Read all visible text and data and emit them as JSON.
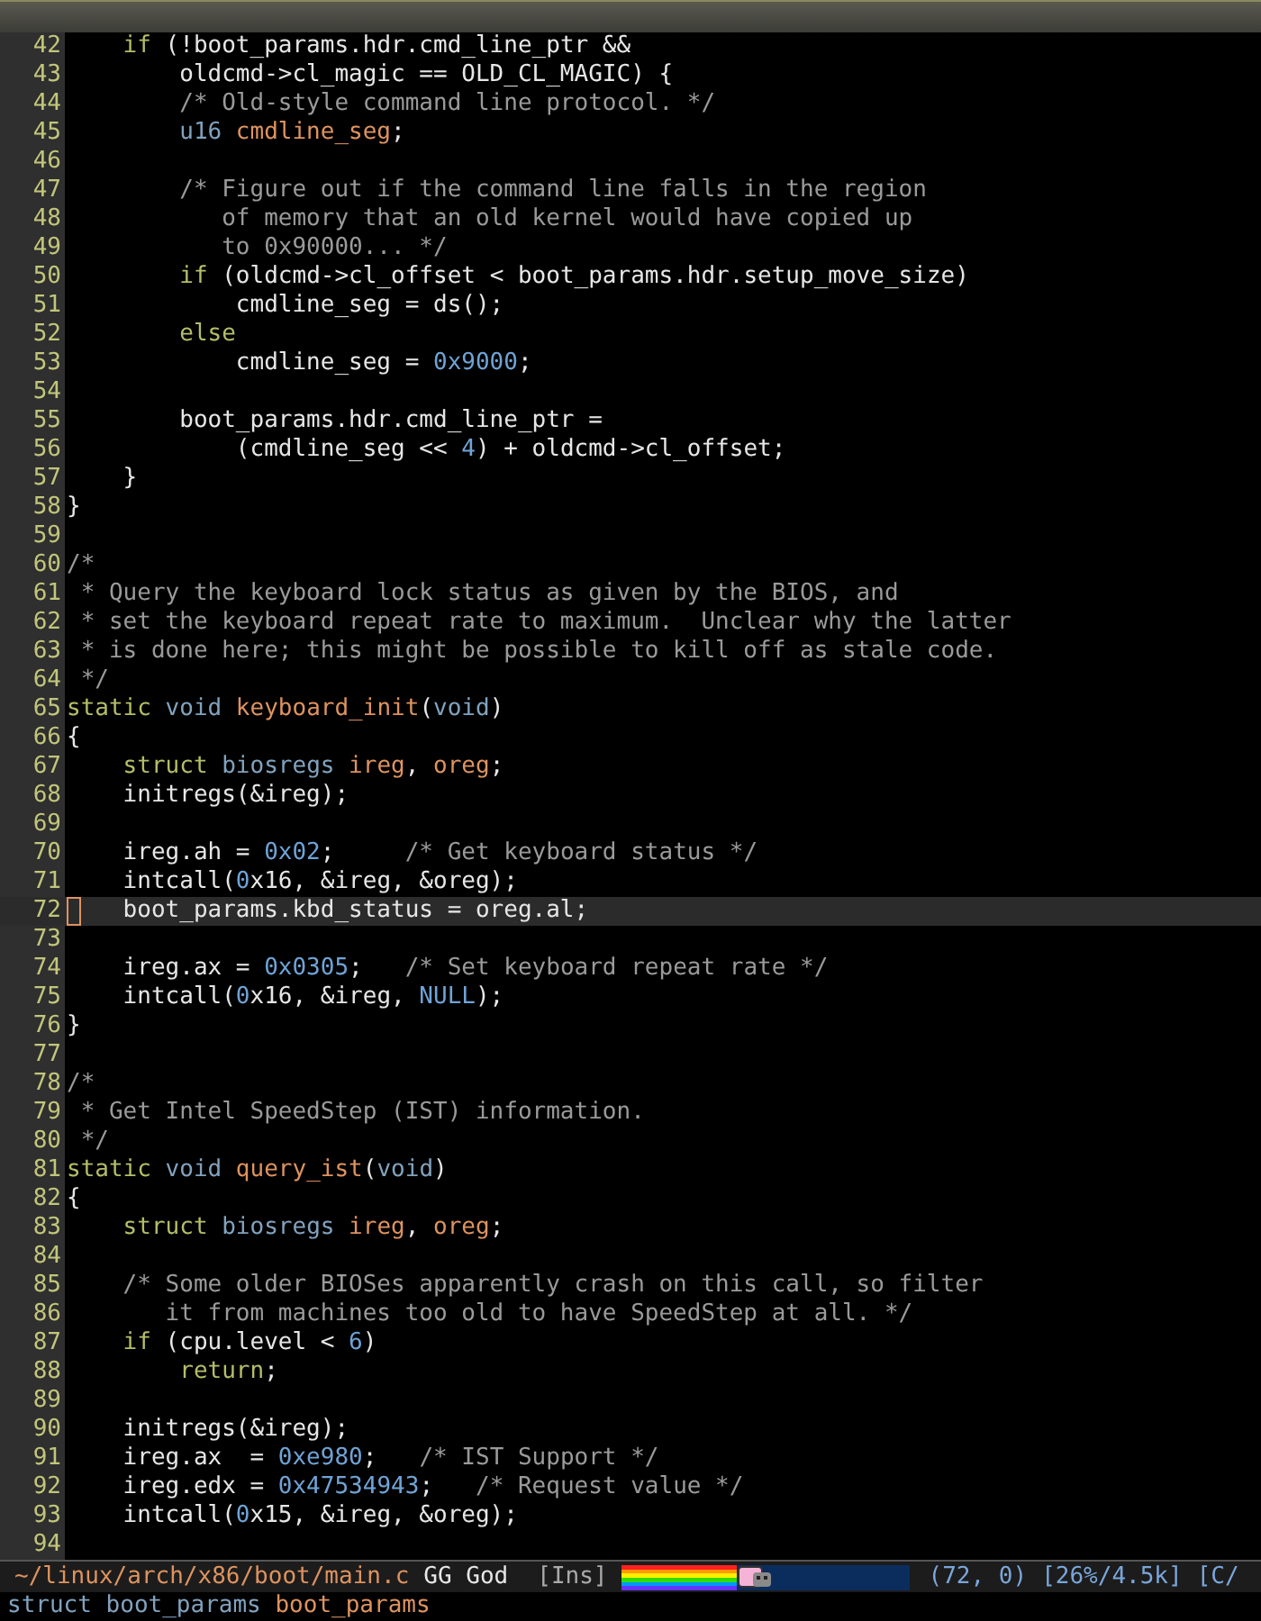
{
  "lines": [
    {
      "number": "42",
      "current": false,
      "segments": [
        {
          "kind": "keyword",
          "text": "    if"
        },
        {
          "kind": "plain",
          "text": " (!boot_params.hdr.cmd_line_ptr &&"
        }
      ]
    },
    {
      "number": "43",
      "current": false,
      "segments": [
        {
          "kind": "plain",
          "text": "        oldcmd->cl_magic == OLD_CL_MAGIC) {"
        }
      ]
    },
    {
      "number": "44",
      "current": false,
      "segments": [
        {
          "kind": "comment",
          "text": "        /* Old-style command line protocol. */"
        }
      ]
    },
    {
      "number": "45",
      "current": false,
      "segments": [
        {
          "kind": "type",
          "text": "        u16"
        },
        {
          "kind": "name",
          "text": " cmdline_seg"
        },
        {
          "kind": "plain",
          "text": ";"
        }
      ]
    },
    {
      "number": "46",
      "current": false
    },
    {
      "number": "47",
      "current": false,
      "segments": [
        {
          "kind": "comment",
          "text": "        /* Figure out if the command line falls in the region"
        }
      ]
    },
    {
      "number": "48",
      "current": false,
      "segments": [
        {
          "kind": "comment",
          "text": "           of memory that an old kernel would have copied up"
        }
      ]
    },
    {
      "number": "49",
      "current": false,
      "segments": [
        {
          "kind": "comment",
          "text": "           to 0x90000... */"
        }
      ]
    },
    {
      "number": "50",
      "current": false,
      "segments": [
        {
          "kind": "keyword",
          "text": "        if"
        },
        {
          "kind": "plain",
          "text": " (oldcmd->cl_offset < boot_params.hdr.setup_move_size)"
        }
      ]
    },
    {
      "number": "51",
      "current": false,
      "segments": [
        {
          "kind": "plain",
          "text": "            cmdline_seg = ds();"
        }
      ]
    },
    {
      "number": "52",
      "current": false,
      "segments": [
        {
          "kind": "keyword",
          "text": "        else"
        }
      ]
    },
    {
      "number": "53",
      "current": false,
      "segments": [
        {
          "kind": "plain",
          "text": "            cmdline_seg = "
        },
        {
          "kind": "number",
          "text": "0x9000"
        },
        {
          "kind": "plain",
          "text": ";"
        }
      ]
    },
    {
      "number": "54",
      "current": false
    },
    {
      "number": "55",
      "current": false,
      "segments": [
        {
          "kind": "plain",
          "text": "        boot_params.hdr.cmd_line_ptr ="
        }
      ]
    },
    {
      "number": "56",
      "current": false,
      "segments": [
        {
          "kind": "plain",
          "text": "            (cmdline_seg << "
        },
        {
          "kind": "number",
          "text": "4"
        },
        {
          "kind": "plain",
          "text": ") + oldcmd->cl_offset;"
        }
      ]
    },
    {
      "number": "57",
      "current": false,
      "segments": [
        {
          "kind": "plain",
          "text": "    }"
        }
      ]
    },
    {
      "number": "58",
      "current": false,
      "segments": [
        {
          "kind": "plain",
          "text": "}"
        }
      ]
    },
    {
      "number": "59",
      "current": false
    },
    {
      "number": "60",
      "current": false,
      "segments": [
        {
          "kind": "comment",
          "text": "/*"
        }
      ]
    },
    {
      "number": "61",
      "current": false,
      "segments": [
        {
          "kind": "comment",
          "text": " * Query the keyboard lock status as given by the BIOS, and"
        }
      ]
    },
    {
      "number": "62",
      "current": false,
      "segments": [
        {
          "kind": "comment",
          "text": " * set the keyboard repeat rate to maximum.  Unclear why the latter"
        }
      ]
    },
    {
      "number": "63",
      "current": false,
      "segments": [
        {
          "kind": "comment",
          "text": " * is done here; this might be possible to kill off as stale code."
        }
      ]
    },
    {
      "number": "64",
      "current": false,
      "segments": [
        {
          "kind": "comment",
          "text": " */"
        }
      ]
    },
    {
      "number": "65",
      "current": false,
      "segments": [
        {
          "kind": "keyword",
          "text": "static"
        },
        {
          "kind": "type",
          "text": " void"
        },
        {
          "kind": "name",
          "text": " keyboard_init"
        },
        {
          "kind": "plain",
          "text": "("
        },
        {
          "kind": "type",
          "text": "void"
        },
        {
          "kind": "plain",
          "text": ")"
        }
      ]
    },
    {
      "number": "66",
      "current": false,
      "segments": [
        {
          "kind": "plain",
          "text": "{"
        }
      ]
    },
    {
      "number": "67",
      "current": false,
      "segments": [
        {
          "kind": "keyword",
          "text": "    struct"
        },
        {
          "kind": "type",
          "text": " biosregs"
        },
        {
          "kind": "name",
          "text": " ireg"
        },
        {
          "kind": "plain",
          "text": ", "
        },
        {
          "kind": "name",
          "text": "oreg"
        },
        {
          "kind": "plain",
          "text": ";"
        }
      ]
    },
    {
      "number": "68",
      "current": false,
      "segments": [
        {
          "kind": "plain",
          "text": "    initregs(&ireg);"
        }
      ]
    },
    {
      "number": "69",
      "current": false
    },
    {
      "number": "70",
      "current": false,
      "segments": [
        {
          "kind": "plain",
          "text": "    ireg.ah = "
        },
        {
          "kind": "number",
          "text": "0x02"
        },
        {
          "kind": "plain",
          "text": ";     "
        },
        {
          "kind": "comment",
          "text": "/* Get keyboard status */"
        }
      ]
    },
    {
      "number": "71",
      "current": false,
      "segments": [
        {
          "kind": "plain",
          "text": "    intcall("
        },
        {
          "kind": "number",
          "text": "0"
        },
        {
          "kind": "plain",
          "text": "x16, &ireg, &oreg);"
        }
      ]
    },
    {
      "number": "72",
      "current": true,
      "segments": [
        {
          "kind": "plain",
          "text": "    boot_params.kbd_status = oreg.al;"
        }
      ]
    },
    {
      "number": "73",
      "current": false
    },
    {
      "number": "74",
      "current": false,
      "segments": [
        {
          "kind": "plain",
          "text": "    ireg.ax = "
        },
        {
          "kind": "number",
          "text": "0x0305"
        },
        {
          "kind": "plain",
          "text": ";   "
        },
        {
          "kind": "comment",
          "text": "/* Set keyboard repeat rate */"
        }
      ]
    },
    {
      "number": "75",
      "current": false,
      "segments": [
        {
          "kind": "plain",
          "text": "    intcall("
        },
        {
          "kind": "number",
          "text": "0"
        },
        {
          "kind": "plain",
          "text": "x16, &ireg, "
        },
        {
          "kind": "number",
          "text": "NULL"
        },
        {
          "kind": "plain",
          "text": ");"
        }
      ]
    },
    {
      "number": "76",
      "current": false,
      "segments": [
        {
          "kind": "plain",
          "text": "}"
        }
      ]
    },
    {
      "number": "77",
      "current": false
    },
    {
      "number": "78",
      "current": false,
      "segments": [
        {
          "kind": "comment",
          "text": "/*"
        }
      ]
    },
    {
      "number": "79",
      "current": false,
      "segments": [
        {
          "kind": "comment",
          "text": " * Get Intel SpeedStep (IST) information."
        }
      ]
    },
    {
      "number": "80",
      "current": false,
      "segments": [
        {
          "kind": "comment",
          "text": " */"
        }
      ]
    },
    {
      "number": "81",
      "current": false,
      "segments": [
        {
          "kind": "keyword",
          "text": "static"
        },
        {
          "kind": "type",
          "text": " void"
        },
        {
          "kind": "name",
          "text": " query_ist"
        },
        {
          "kind": "plain",
          "text": "("
        },
        {
          "kind": "type",
          "text": "void"
        },
        {
          "kind": "plain",
          "text": ")"
        }
      ]
    },
    {
      "number": "82",
      "current": false,
      "segments": [
        {
          "kind": "plain",
          "text": "{"
        }
      ]
    },
    {
      "number": "83",
      "current": false,
      "segments": [
        {
          "kind": "keyword",
          "text": "    struct"
        },
        {
          "kind": "type",
          "text": " biosregs"
        },
        {
          "kind": "name",
          "text": " ireg"
        },
        {
          "kind": "plain",
          "text": ", "
        },
        {
          "kind": "name",
          "text": "oreg"
        },
        {
          "kind": "plain",
          "text": ";"
        }
      ]
    },
    {
      "number": "84",
      "current": false
    },
    {
      "number": "85",
      "current": false,
      "segments": [
        {
          "kind": "comment",
          "text": "    /* Some older BIOSes apparently crash on this call, so filter"
        }
      ]
    },
    {
      "number": "86",
      "current": false,
      "segments": [
        {
          "kind": "comment",
          "text": "       it from machines too old to have SpeedStep at all. */"
        }
      ]
    },
    {
      "number": "87",
      "current": false,
      "segments": [
        {
          "kind": "keyword",
          "text": "    if"
        },
        {
          "kind": "plain",
          "text": " (cpu.level < "
        },
        {
          "kind": "number",
          "text": "6"
        },
        {
          "kind": "plain",
          "text": ")"
        }
      ]
    },
    {
      "number": "88",
      "current": false,
      "segments": [
        {
          "kind": "keyword",
          "text": "        return"
        },
        {
          "kind": "plain",
          "text": ";"
        }
      ]
    },
    {
      "number": "89",
      "current": false
    },
    {
      "number": "90",
      "current": false,
      "segments": [
        {
          "kind": "plain",
          "text": "    initregs(&ireg);"
        }
      ]
    },
    {
      "number": "91",
      "current": false,
      "segments": [
        {
          "kind": "plain",
          "text": "    ireg.ax  = "
        },
        {
          "kind": "number",
          "text": "0xe980"
        },
        {
          "kind": "plain",
          "text": ";   "
        },
        {
          "kind": "comment",
          "text": "/* IST Support */"
        }
      ]
    },
    {
      "number": "92",
      "current": false,
      "segments": [
        {
          "kind": "plain",
          "text": "    ireg.edx = "
        },
        {
          "kind": "number",
          "text": "0x47534943"
        },
        {
          "kind": "plain",
          "text": ";   "
        },
        {
          "kind": "comment",
          "text": "/* Request value */"
        }
      ]
    },
    {
      "number": "93",
      "current": false,
      "segments": [
        {
          "kind": "plain",
          "text": "    intcall("
        },
        {
          "kind": "number",
          "text": "0"
        },
        {
          "kind": "plain",
          "text": "x15, &ireg, &oreg);"
        }
      ]
    },
    {
      "number": "94",
      "current": false
    }
  ],
  "mode_line": {
    "file_path": "~/linux/arch/x86/boot/main.c",
    "modes": "GG God",
    "input_state": "[Ins]",
    "scroll_indicator": {
      "level": 0.4
    },
    "position": "(72, 0)",
    "size": "[26%/4.5k]",
    "major_mode": "[C/"
  },
  "echo_area": {
    "segments": [
      {
        "kind": "type",
        "text": "struct boot_params"
      },
      {
        "kind": "name",
        "text": " boot_params"
      }
    ]
  }
}
